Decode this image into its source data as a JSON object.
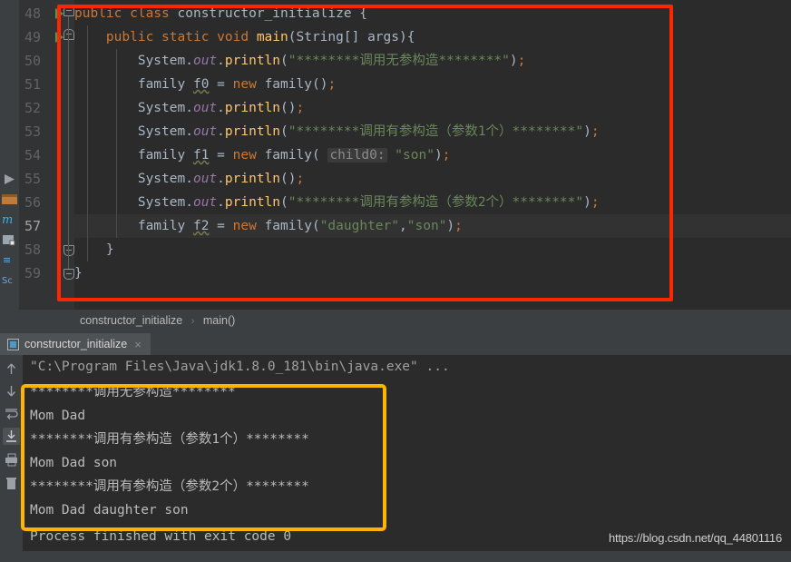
{
  "theme": {
    "editor_bg": "#2b2b2b",
    "gutter_bg": "#313335",
    "panel_bg": "#3c3f41",
    "keyword": "#cc7832",
    "string": "#6a8759",
    "method": "#ffc66d",
    "field": "#9876aa",
    "text": "#a9b7c6",
    "annotation_red": "#fe2600",
    "annotation_yellow": "#ffb400"
  },
  "editor": {
    "lines": [
      {
        "num": "48",
        "run_marker": true,
        "fold": "top",
        "highlight": false,
        "text": "public class constructor_initialize {"
      },
      {
        "num": "49",
        "run_marker": true,
        "fold": "top",
        "highlight": false,
        "text": "    public static void main(String[] args){"
      },
      {
        "num": "50",
        "run_marker": false,
        "fold": "",
        "highlight": false,
        "text": "        System.out.println(\"********调用无参构造********\");"
      },
      {
        "num": "51",
        "run_marker": false,
        "fold": "",
        "highlight": false,
        "text": "        family f0 = new family();"
      },
      {
        "num": "52",
        "run_marker": false,
        "fold": "",
        "highlight": false,
        "text": "        System.out.println();"
      },
      {
        "num": "53",
        "run_marker": false,
        "fold": "",
        "highlight": false,
        "text": "        System.out.println(\"********调用有参构造（参数1个）********\");"
      },
      {
        "num": "54",
        "run_marker": false,
        "fold": "",
        "highlight": false,
        "text": "        family f1 = new family( child0: \"son\");"
      },
      {
        "num": "55",
        "run_marker": false,
        "fold": "",
        "highlight": false,
        "text": "        System.out.println();"
      },
      {
        "num": "56",
        "run_marker": false,
        "fold": "",
        "highlight": false,
        "text": "        System.out.println(\"********调用有参构造（参数2个）********\");"
      },
      {
        "num": "57",
        "run_marker": false,
        "fold": "",
        "highlight": true,
        "text": "        family f2 = new family(\"daughter\",\"son\");"
      },
      {
        "num": "58",
        "run_marker": false,
        "fold": "bot",
        "highlight": false,
        "text": "    }"
      },
      {
        "num": "59",
        "run_marker": false,
        "fold": "bot",
        "highlight": false,
        "text": "}"
      }
    ],
    "parameter_hint": "child0:"
  },
  "breadcrumb": {
    "class": "constructor_initialize",
    "separator": "›",
    "method": "main()"
  },
  "run_window": {
    "tab_label": "constructor_initialize",
    "tab_close": "×",
    "command_line": "\"C:\\Program Files\\Java\\jdk1.8.0_181\\bin\\java.exe\" ...",
    "output": [
      "********调用无参构造********",
      "Mom Dad",
      "********调用有参构造（参数1个）********",
      "Mom Dad son",
      "********调用有参构造（参数2个）********",
      "Mom Dad daughter son"
    ],
    "exit_line": "Process finished with exit code 0"
  },
  "watermark": "https://blog.csdn.net/qq_44801116"
}
